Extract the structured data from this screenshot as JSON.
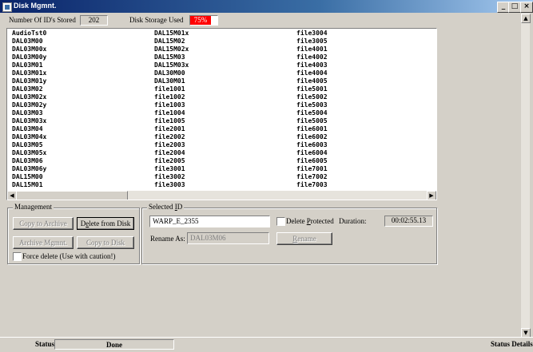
{
  "window": {
    "title": "Disk Mgmnt.",
    "controls": {
      "minimize": "_",
      "maximize": "□",
      "close": "×"
    }
  },
  "header": {
    "count_label": "Number Of ID's Stored",
    "count_value": "202",
    "storage_label": "Disk Storage Used",
    "storage_value": "75%",
    "storage_percent": 75,
    "storage_color": "#ff0000"
  },
  "list": {
    "columns": [
      [
        "AudioTst0",
        "DAL03M00",
        "DAL03M00x",
        "DAL03M00y",
        "DAL03M01",
        "DAL03M01x",
        "DAL03M01y",
        "DAL03M02",
        "DAL03M02x",
        "DAL03M02y",
        "DAL03M03",
        "DAL03M03x",
        "DAL03M04",
        "DAL03M04x",
        "DAL03M05",
        "DAL03M05x",
        "DAL03M06",
        "DAL03M06y",
        "DAL15M00",
        "DAL15M01"
      ],
      [
        "DAL15M01x",
        "DAL15M02",
        "DAL15M02x",
        "DAL15M03",
        "DAL15M03x",
        "DAL30M00",
        "DAL30M01",
        "file1001",
        "file1002",
        "file1003",
        "file1004",
        "file1005",
        "file2001",
        "file2002",
        "file2003",
        "file2004",
        "file2005",
        "file3001",
        "file3002",
        "file3003"
      ],
      [
        "file3004",
        "file3005",
        "file4001",
        "file4002",
        "file4003",
        "file4004",
        "file4005",
        "file5001",
        "file5002",
        "file5003",
        "file5004",
        "file5005",
        "file6001",
        "file6002",
        "file6003",
        "file6004",
        "file6005",
        "file7001",
        "file7002",
        "file7003"
      ]
    ]
  },
  "management": {
    "legend": "Management",
    "copy_to_archive": "Copy to Archive",
    "delete_from_disk_pre": "D",
    "delete_from_disk_ul": "e",
    "delete_from_disk_post": "lete from Disk",
    "archive_mgmnt": "Archive Mgmnt.",
    "copy_to_disk": "Copy to Disk",
    "force_delete": "Force delete (Use with caution!)"
  },
  "selected": {
    "legend_pre": "Selected ",
    "legend_ul": "I",
    "legend_post": "D",
    "id_value": "WARP_E_2355",
    "delete_protected_pre": "Delete ",
    "delete_protected_ul": "P",
    "delete_protected_post": "rotected",
    "duration_label": "Duration:",
    "duration_value": "00:02:55.13",
    "rename_as_label": "Rename As:",
    "rename_as_value": "DAL03M06",
    "rename_button_ul": "R",
    "rename_button_post": "ename"
  },
  "statusbar": {
    "status_label": "Status",
    "status_value": "Done",
    "details_label": "Status Details"
  }
}
